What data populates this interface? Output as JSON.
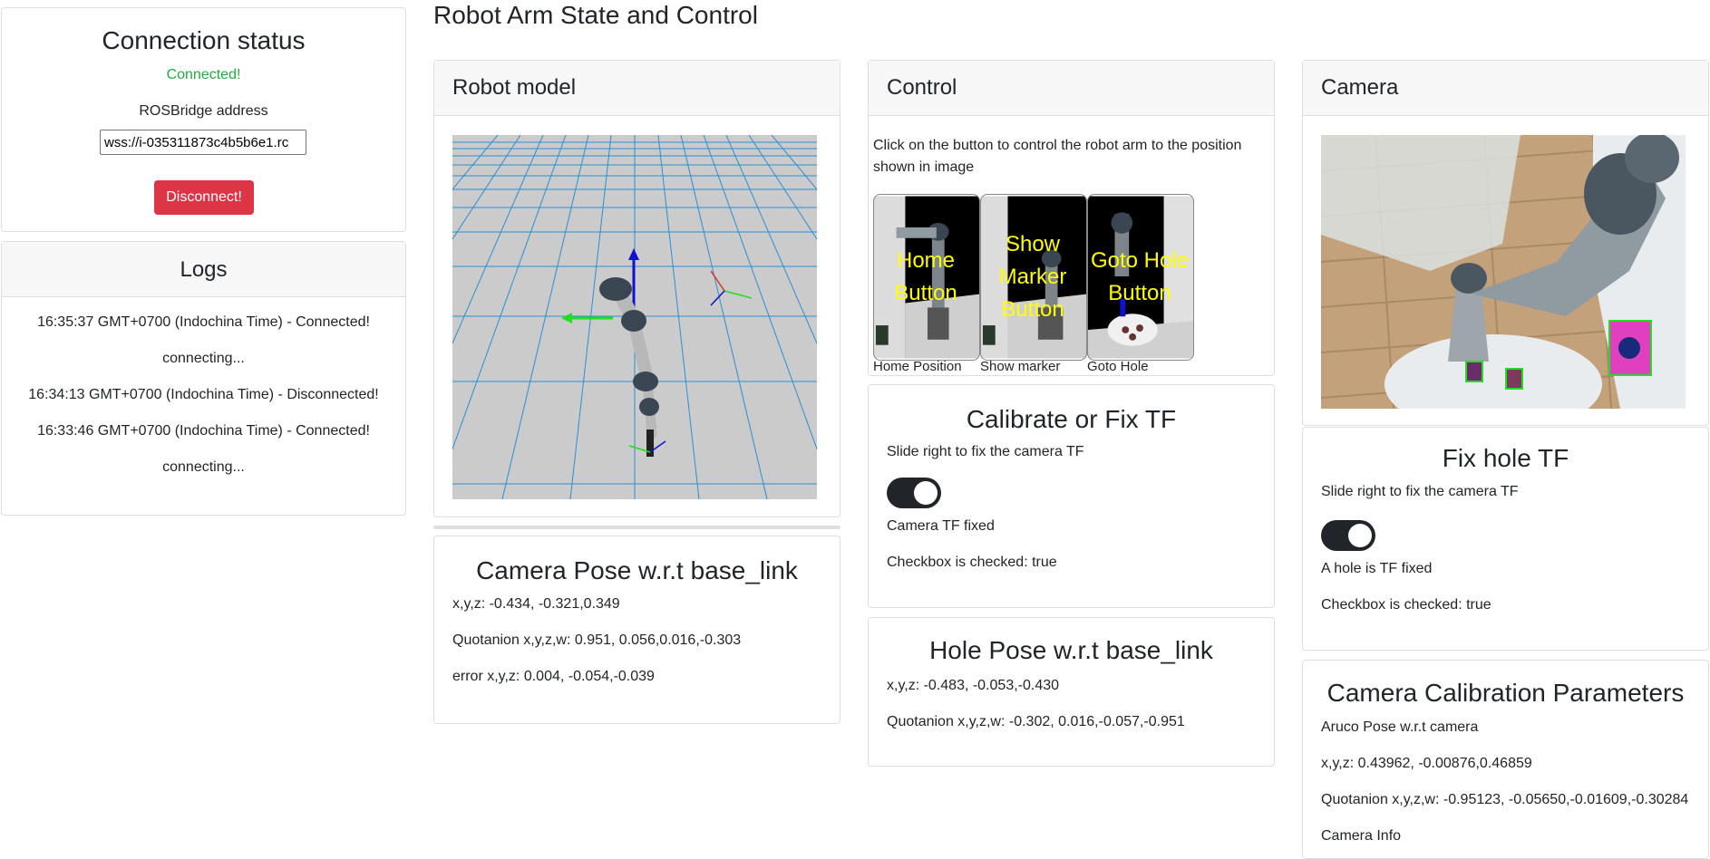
{
  "connection": {
    "title": "Connection status",
    "status": "Connected!",
    "address_label": "ROSBridge address",
    "address_value": "wss://i-035311873c4b5b6e1.rc",
    "disconnect_label": "Disconnect!"
  },
  "logs": {
    "title": "Logs",
    "entries": [
      "16:35:37 GMT+0700 (Indochina Time) - Connected!",
      "connecting...",
      "16:34:13 GMT+0700 (Indochina Time) - Disconnected!",
      "16:33:46 GMT+0700 (Indochina Time) - Connected!",
      "connecting..."
    ]
  },
  "page_title": "Robot Arm State and Control",
  "robot_model": {
    "title": "Robot model"
  },
  "control": {
    "title": "Control",
    "description": "Click on the button to control the robot arm to the position shown in image",
    "buttons": [
      {
        "overlay": "Home Button",
        "caption": "Home Position"
      },
      {
        "overlay": "Show Marker Button",
        "caption": "Show marker"
      },
      {
        "overlay": "Goto Hole Button",
        "caption": "Goto Hole"
      }
    ]
  },
  "camera": {
    "title": "Camera"
  },
  "camera_pose": {
    "title": "Camera Pose w.r.t base_link",
    "xyz": "x,y,z: -0.434, -0.321,0.349",
    "quat": "Quotanion x,y,z,w: 0.951, 0.056,0.016,-0.303",
    "error": "error x,y,z: 0.004, -0.054,-0.039"
  },
  "calibrate_tf": {
    "title": "Calibrate or Fix TF",
    "hint": "Slide right to fix the camera TF",
    "toggle_on": true,
    "toggle_label": "Camera TF fixed",
    "checked_text": "Checkbox is checked: true"
  },
  "hole_pose": {
    "title": "Hole Pose w.r.t base_link",
    "xyz": "x,y,z: -0.483, -0.053,-0.430",
    "quat": "Quotanion x,y,z,w: -0.302, 0.016,-0.057,-0.951"
  },
  "fix_hole": {
    "title": "Fix hole TF",
    "hint": "Slide right to fix the camera TF",
    "toggle_on": true,
    "toggle_label": "A hole is TF fixed",
    "checked_text": "Checkbox is checked: true"
  },
  "calib_params": {
    "title": "Camera Calibration Parameters",
    "aruco_label": "Aruco Pose w.r.t camera",
    "xyz": "x,y,z: 0.43962, -0.00876,0.46859",
    "quat": "Quotanion x,y,z,w: -0.95123, -0.05650,-0.01609,-0.30284",
    "info_label": "Camera Info"
  },
  "colors": {
    "success": "#28a745",
    "danger": "#dc3545",
    "grid": "#2b8fd0",
    "overlay_text": "#ffff00"
  }
}
